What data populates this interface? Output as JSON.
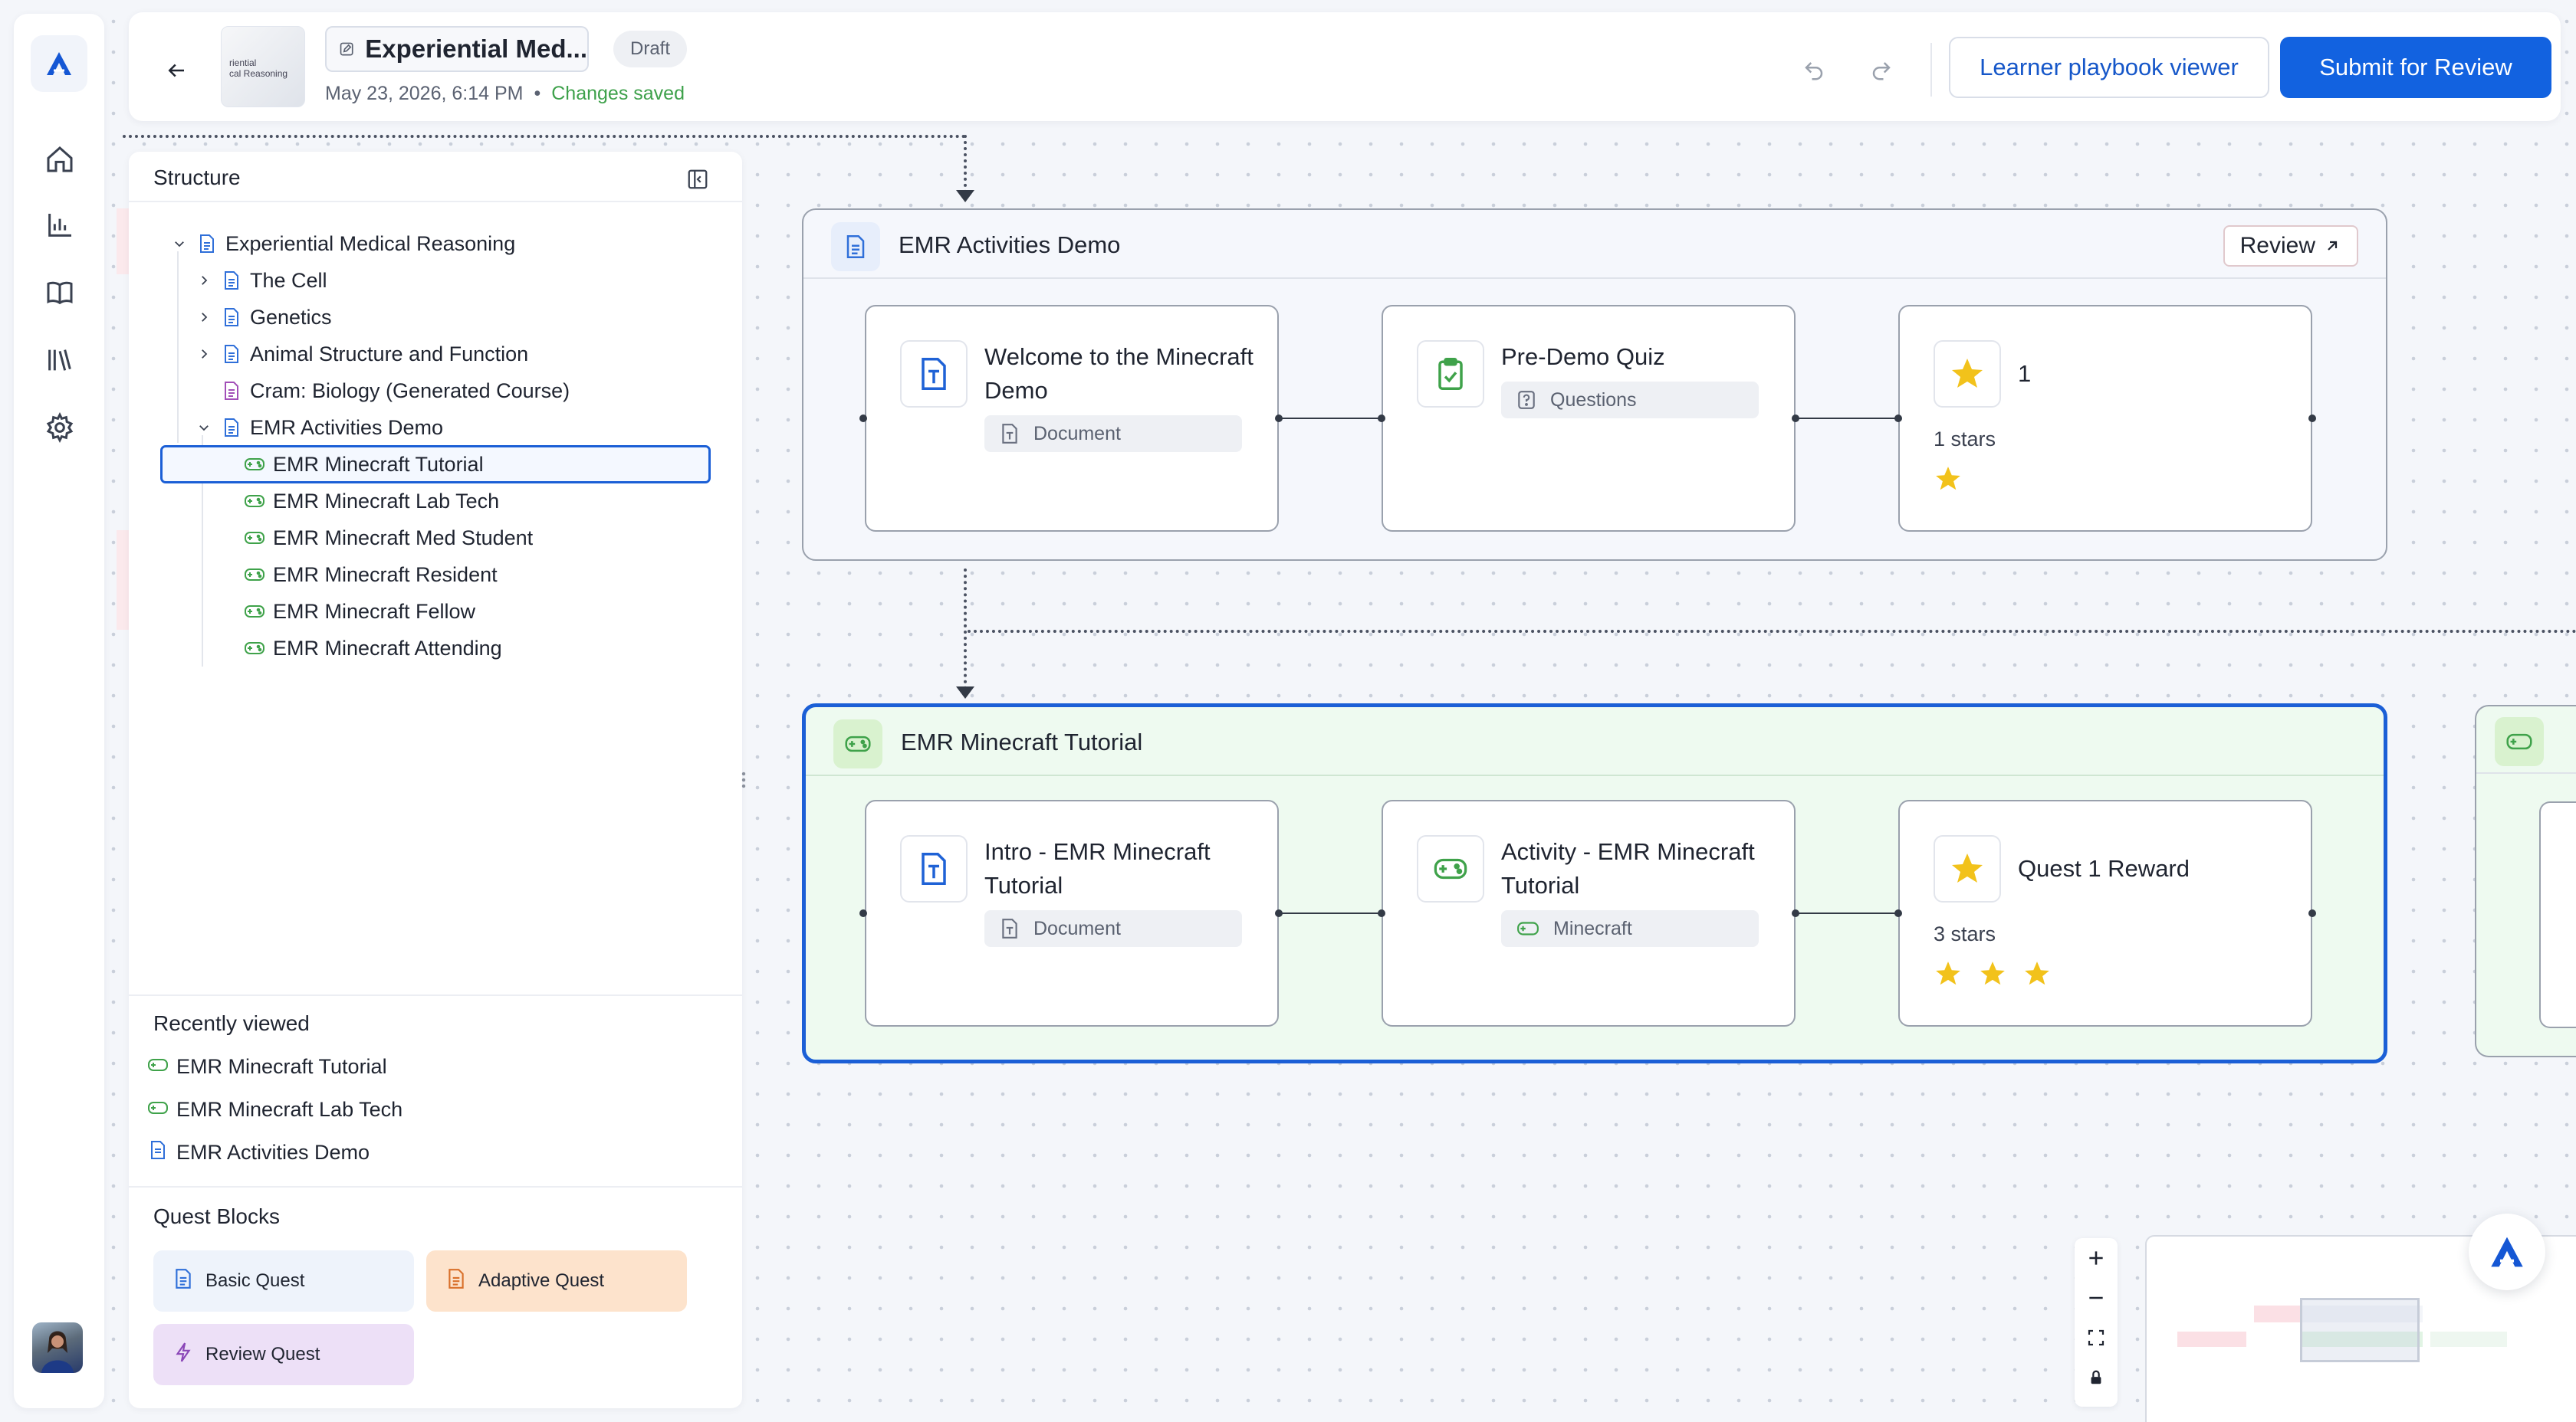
{
  "header": {
    "thumbnail_text": "riential\ncal Reasoning",
    "title": "Experiential Med...",
    "status": "Draft",
    "date": "May 23, 2026, 6:14 PM",
    "separator": "•",
    "save_state": "Changes saved",
    "viewer_button": "Learner playbook viewer",
    "submit_button": "Submit for Review"
  },
  "structure": {
    "title": "Structure",
    "tree": [
      {
        "label": "Experiential Medical Reasoning",
        "icon": "document-icon",
        "level": 0,
        "expanded": true
      },
      {
        "label": "The Cell",
        "icon": "document-icon",
        "level": 1,
        "expanded": false
      },
      {
        "label": "Genetics",
        "icon": "document-icon",
        "level": 1,
        "expanded": false
      },
      {
        "label": "Animal Structure and Function",
        "icon": "document-icon",
        "level": 1,
        "expanded": false
      },
      {
        "label": "Cram: Biology (Generated Course)",
        "icon": "document-icon",
        "level": 1
      },
      {
        "label": "EMR Activities Demo",
        "icon": "document-icon",
        "level": 1,
        "expanded": true
      },
      {
        "label": "EMR Minecraft Tutorial",
        "icon": "gamepad-icon",
        "level": 2,
        "selected": true
      },
      {
        "label": "EMR Minecraft Lab Tech",
        "icon": "gamepad-icon",
        "level": 2
      },
      {
        "label": "EMR Minecraft Med Student",
        "icon": "gamepad-icon",
        "level": 2
      },
      {
        "label": "EMR Minecraft Resident",
        "icon": "gamepad-icon",
        "level": 2
      },
      {
        "label": "EMR Minecraft Fellow",
        "icon": "gamepad-icon",
        "level": 2
      },
      {
        "label": "EMR Minecraft Attending",
        "icon": "gamepad-icon",
        "level": 2
      }
    ],
    "recently_viewed_title": "Recently viewed",
    "recently_viewed": [
      {
        "label": "EMR Minecraft Tutorial",
        "icon": "gamepad-icon"
      },
      {
        "label": "EMR Minecraft Lab Tech",
        "icon": "gamepad-icon"
      },
      {
        "label": "EMR Activities Demo",
        "icon": "document-icon"
      }
    ],
    "quest_blocks_title": "Quest Blocks",
    "quest_blocks": [
      {
        "label": "Basic Quest",
        "icon": "document-icon"
      },
      {
        "label": "Adaptive Quest",
        "icon": "document-icon"
      },
      {
        "label": "Review Quest",
        "icon": "lightning-icon"
      }
    ]
  },
  "flow": {
    "group1": {
      "title": "EMR Activities Demo",
      "review_label": "Review",
      "cards": [
        {
          "title": "Welcome to the Minecraft Demo",
          "tag": "Document"
        },
        {
          "title": "Pre-Demo Quiz",
          "tag": "Questions"
        },
        {
          "title": "1",
          "stars_label": "1 stars",
          "stars": 1
        }
      ]
    },
    "group2": {
      "title": "EMR Minecraft Tutorial",
      "cards": [
        {
          "title": "Intro - EMR Minecraft Tutorial",
          "tag": "Document"
        },
        {
          "title": "Activity - EMR Minecraft Tutorial",
          "tag": "Minecraft"
        },
        {
          "title": "Quest 1 Reward",
          "stars_label": "3 stars",
          "stars": 3
        }
      ]
    }
  },
  "colors": {
    "primary": "#1262e0",
    "saved": "#3ea14b",
    "selected_group_bg": "#eefaf0",
    "selected_group_border": "#1b5fd6",
    "star": "#f2c21b"
  }
}
